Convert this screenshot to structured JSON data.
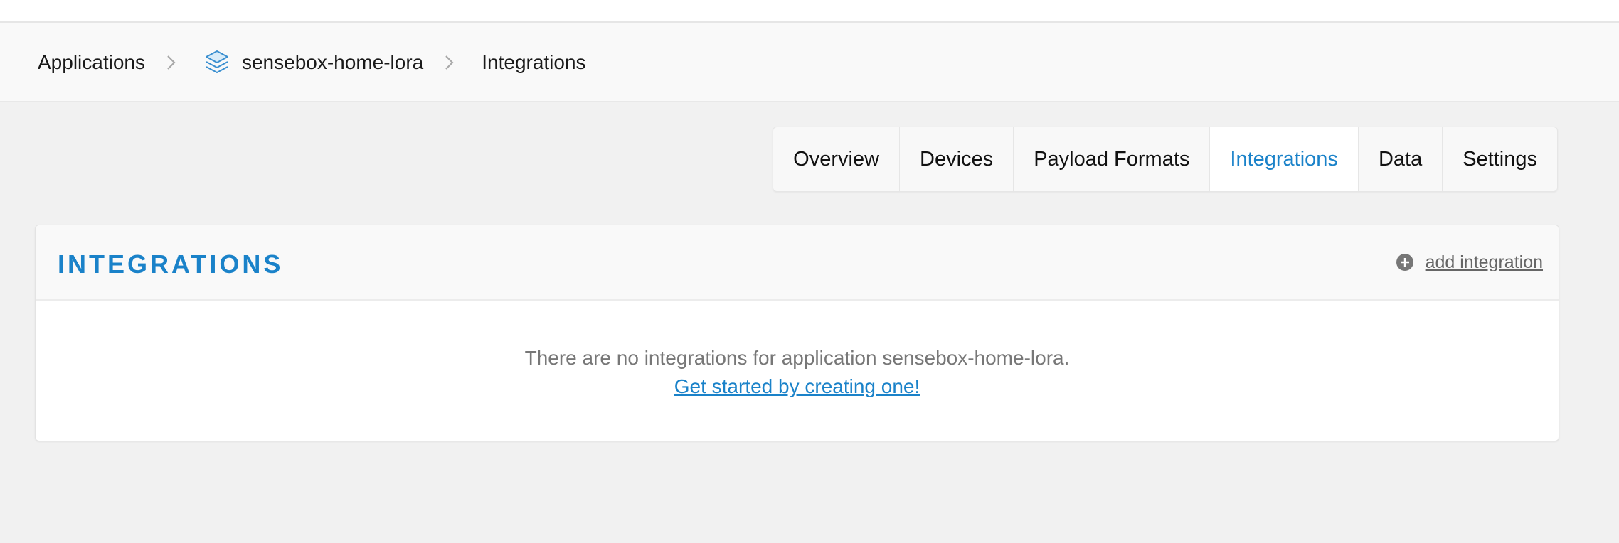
{
  "breadcrumb": {
    "root": "Applications",
    "app": "sensebox-home-lora",
    "current": "Integrations"
  },
  "tabs": [
    {
      "label": "Overview",
      "active": false
    },
    {
      "label": "Devices",
      "active": false
    },
    {
      "label": "Payload Formats",
      "active": false
    },
    {
      "label": "Integrations",
      "active": true
    },
    {
      "label": "Data",
      "active": false
    },
    {
      "label": "Settings",
      "active": false
    }
  ],
  "panel": {
    "title": "INTEGRATIONS",
    "add_label": "add integration",
    "empty_text": "There are no integrations for application sensebox-home-lora.",
    "cta": "Get started by creating one!"
  },
  "icons": {
    "app": "stacked-layers-icon",
    "separator": "chevron-right-icon",
    "add": "plus-circle-icon"
  },
  "colors": {
    "accent": "#1a82c9",
    "background": "#f1f1f1"
  }
}
